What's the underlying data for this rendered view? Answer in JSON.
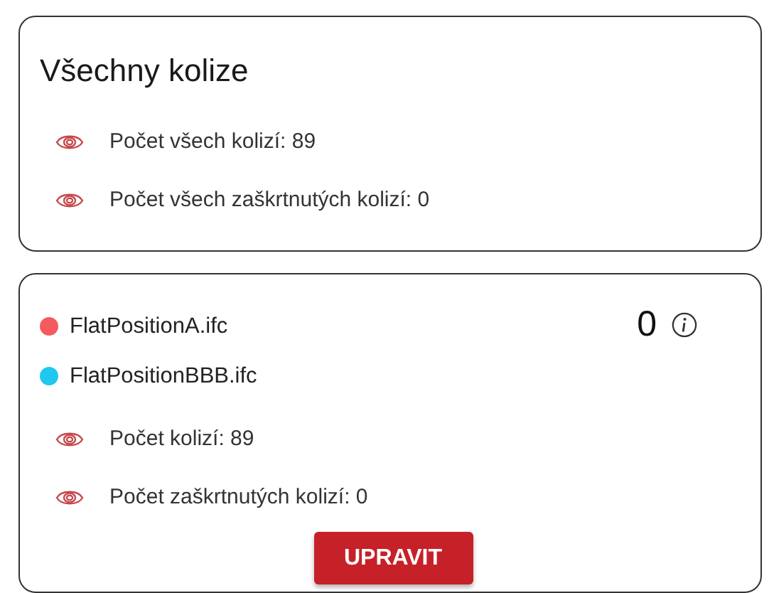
{
  "summary": {
    "title": "Všechny kolize",
    "stats": [
      {
        "label": "Počet všech kolizí: 89"
      },
      {
        "label": "Počet všech zaškrtnutých kolizí: 0"
      }
    ]
  },
  "pair": {
    "files": [
      {
        "name": "FlatPositionA.ifc",
        "color": "#f55a5e"
      },
      {
        "name": "FlatPositionBBB.ifc",
        "color": "#1fc8ef"
      }
    ],
    "count": "0",
    "stats": [
      {
        "label": "Počet kolizí: 89"
      },
      {
        "label": "Počet zaškrtnutých kolizí: 0"
      }
    ],
    "button": "UPRAVIT"
  }
}
